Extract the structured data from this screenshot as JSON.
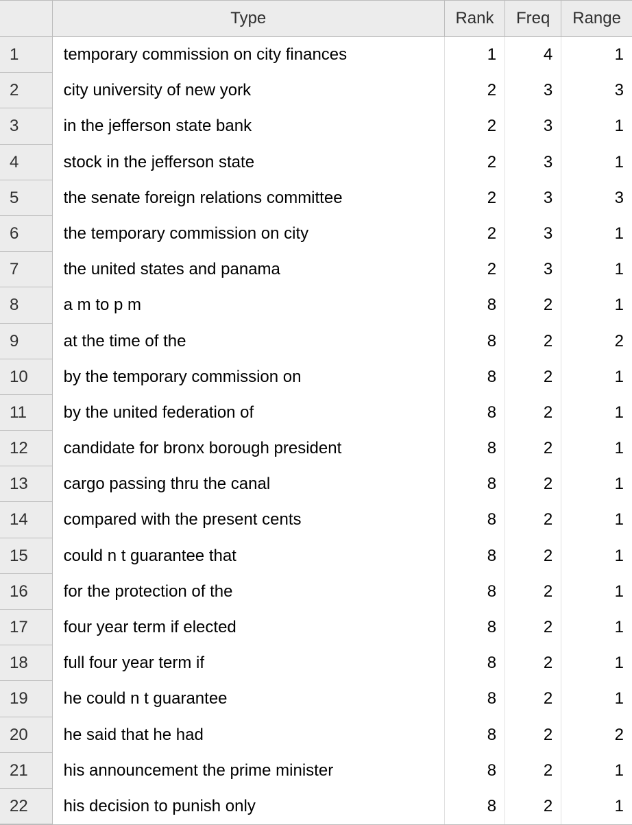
{
  "columns": {
    "index": "",
    "type": "Type",
    "rank": "Rank",
    "freq": "Freq",
    "range": "Range"
  },
  "rows": [
    {
      "n": "1",
      "type": "temporary commission on city finances",
      "rank": "1",
      "freq": "4",
      "range": "1"
    },
    {
      "n": "2",
      "type": "city university of new york",
      "rank": "2",
      "freq": "3",
      "range": "3"
    },
    {
      "n": "3",
      "type": "in the jefferson state bank",
      "rank": "2",
      "freq": "3",
      "range": "1"
    },
    {
      "n": "4",
      "type": "stock in the jefferson state",
      "rank": "2",
      "freq": "3",
      "range": "1"
    },
    {
      "n": "5",
      "type": "the senate foreign relations committee",
      "rank": "2",
      "freq": "3",
      "range": "3"
    },
    {
      "n": "6",
      "type": "the temporary commission on city",
      "rank": "2",
      "freq": "3",
      "range": "1"
    },
    {
      "n": "7",
      "type": "the united states and panama",
      "rank": "2",
      "freq": "3",
      "range": "1"
    },
    {
      "n": "8",
      "type": "a m to p m",
      "rank": "8",
      "freq": "2",
      "range": "1"
    },
    {
      "n": "9",
      "type": "at the time of the",
      "rank": "8",
      "freq": "2",
      "range": "2"
    },
    {
      "n": "10",
      "type": "by the temporary commission on",
      "rank": "8",
      "freq": "2",
      "range": "1"
    },
    {
      "n": "11",
      "type": "by the united federation of",
      "rank": "8",
      "freq": "2",
      "range": "1"
    },
    {
      "n": "12",
      "type": "candidate for bronx borough president",
      "rank": "8",
      "freq": "2",
      "range": "1"
    },
    {
      "n": "13",
      "type": "cargo passing thru the canal",
      "rank": "8",
      "freq": "2",
      "range": "1"
    },
    {
      "n": "14",
      "type": "compared with the present cents",
      "rank": "8",
      "freq": "2",
      "range": "1"
    },
    {
      "n": "15",
      "type": "could n t guarantee that",
      "rank": "8",
      "freq": "2",
      "range": "1"
    },
    {
      "n": "16",
      "type": "for the protection of the",
      "rank": "8",
      "freq": "2",
      "range": "1"
    },
    {
      "n": "17",
      "type": "four year term if elected",
      "rank": "8",
      "freq": "2",
      "range": "1"
    },
    {
      "n": "18",
      "type": "full four year term if",
      "rank": "8",
      "freq": "2",
      "range": "1"
    },
    {
      "n": "19",
      "type": "he could n t guarantee",
      "rank": "8",
      "freq": "2",
      "range": "1"
    },
    {
      "n": "20",
      "type": "he said that he had",
      "rank": "8",
      "freq": "2",
      "range": "2"
    },
    {
      "n": "21",
      "type": "his announcement the prime minister",
      "rank": "8",
      "freq": "2",
      "range": "1"
    },
    {
      "n": "22",
      "type": "his decision to punish only",
      "rank": "8",
      "freq": "2",
      "range": "1"
    }
  ]
}
